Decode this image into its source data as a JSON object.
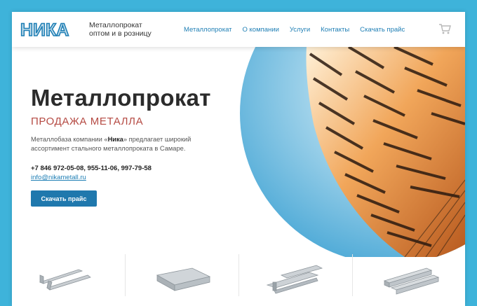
{
  "brand": {
    "logo_text": "НИКА",
    "tagline_line1": "Металлопрокат",
    "tagline_line2": "оптом и в розницу",
    "color": "#1f7fb5"
  },
  "nav": {
    "items": [
      {
        "label": "Металлопрокат"
      },
      {
        "label": "О компании"
      },
      {
        "label": "Услуги"
      },
      {
        "label": "Контакты"
      },
      {
        "label": "Скачать прайс"
      }
    ]
  },
  "cart": {
    "icon": "cart-icon"
  },
  "hero": {
    "title": "Металлопрокат",
    "subtitle": "ПРОДАЖА МЕТАЛЛА",
    "desc_before": "Металлобаза компании «",
    "desc_brand": "Ника",
    "desc_after": "» предлагает широкий ассортимент стального металлопроката в Самаре.",
    "phones": "+7 846 972-05-08,  955-11-06,  997-79-58",
    "email": "info@nikametall.ru",
    "button_label": "Скачать прайс",
    "accent_color": "#b54a43",
    "button_color": "#1f78ad"
  },
  "products": [
    {
      "icon": "angle-steel-icon"
    },
    {
      "icon": "channel-steel-icon"
    },
    {
      "icon": "i-beam-icon"
    },
    {
      "icon": "square-bar-icon"
    }
  ]
}
